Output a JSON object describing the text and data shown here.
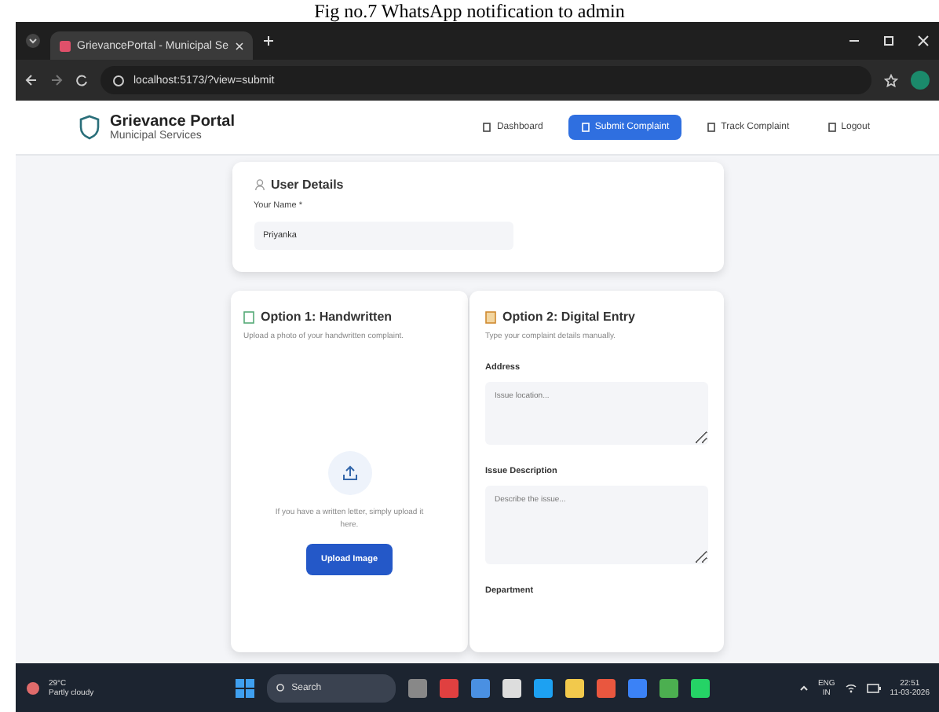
{
  "caption": "Fig no.7 WhatsApp notification to admin",
  "browser": {
    "tab_title": "GrievancePortal - Municipal Se",
    "url": "localhost:5173/?view=submit"
  },
  "header": {
    "title": "Grievance Portal",
    "subtitle": "Municipal Services",
    "nav": [
      {
        "label": "Dashboard",
        "selected": false
      },
      {
        "label": "Submit Complaint",
        "selected": true
      },
      {
        "label": "Track Complaint",
        "selected": false
      },
      {
        "label": "Logout",
        "selected": false
      }
    ]
  },
  "user_details": {
    "title": "User Details",
    "name_label": "Your Name *",
    "name_value": "Priyanka"
  },
  "option1": {
    "title": "Option 1: Handwritten",
    "subtitle": "Upload a photo of your handwritten complaint.",
    "hint": "If you have a written letter, simply upload it here.",
    "button": "Upload Image"
  },
  "option2": {
    "title": "Option 2: Digital Entry",
    "subtitle": "Type your complaint details manually.",
    "fields": [
      {
        "label": "Address",
        "placeholder": "Issue location..."
      },
      {
        "label": "Issue Description",
        "placeholder": "Describe the issue..."
      }
    ],
    "next_label": "Department"
  },
  "taskbar": {
    "temp": "29°C",
    "weather": "Partly cloudy",
    "search": "Search",
    "lang": "ENG",
    "region": "IN",
    "time": "22:51",
    "date": "11-03-2026"
  }
}
